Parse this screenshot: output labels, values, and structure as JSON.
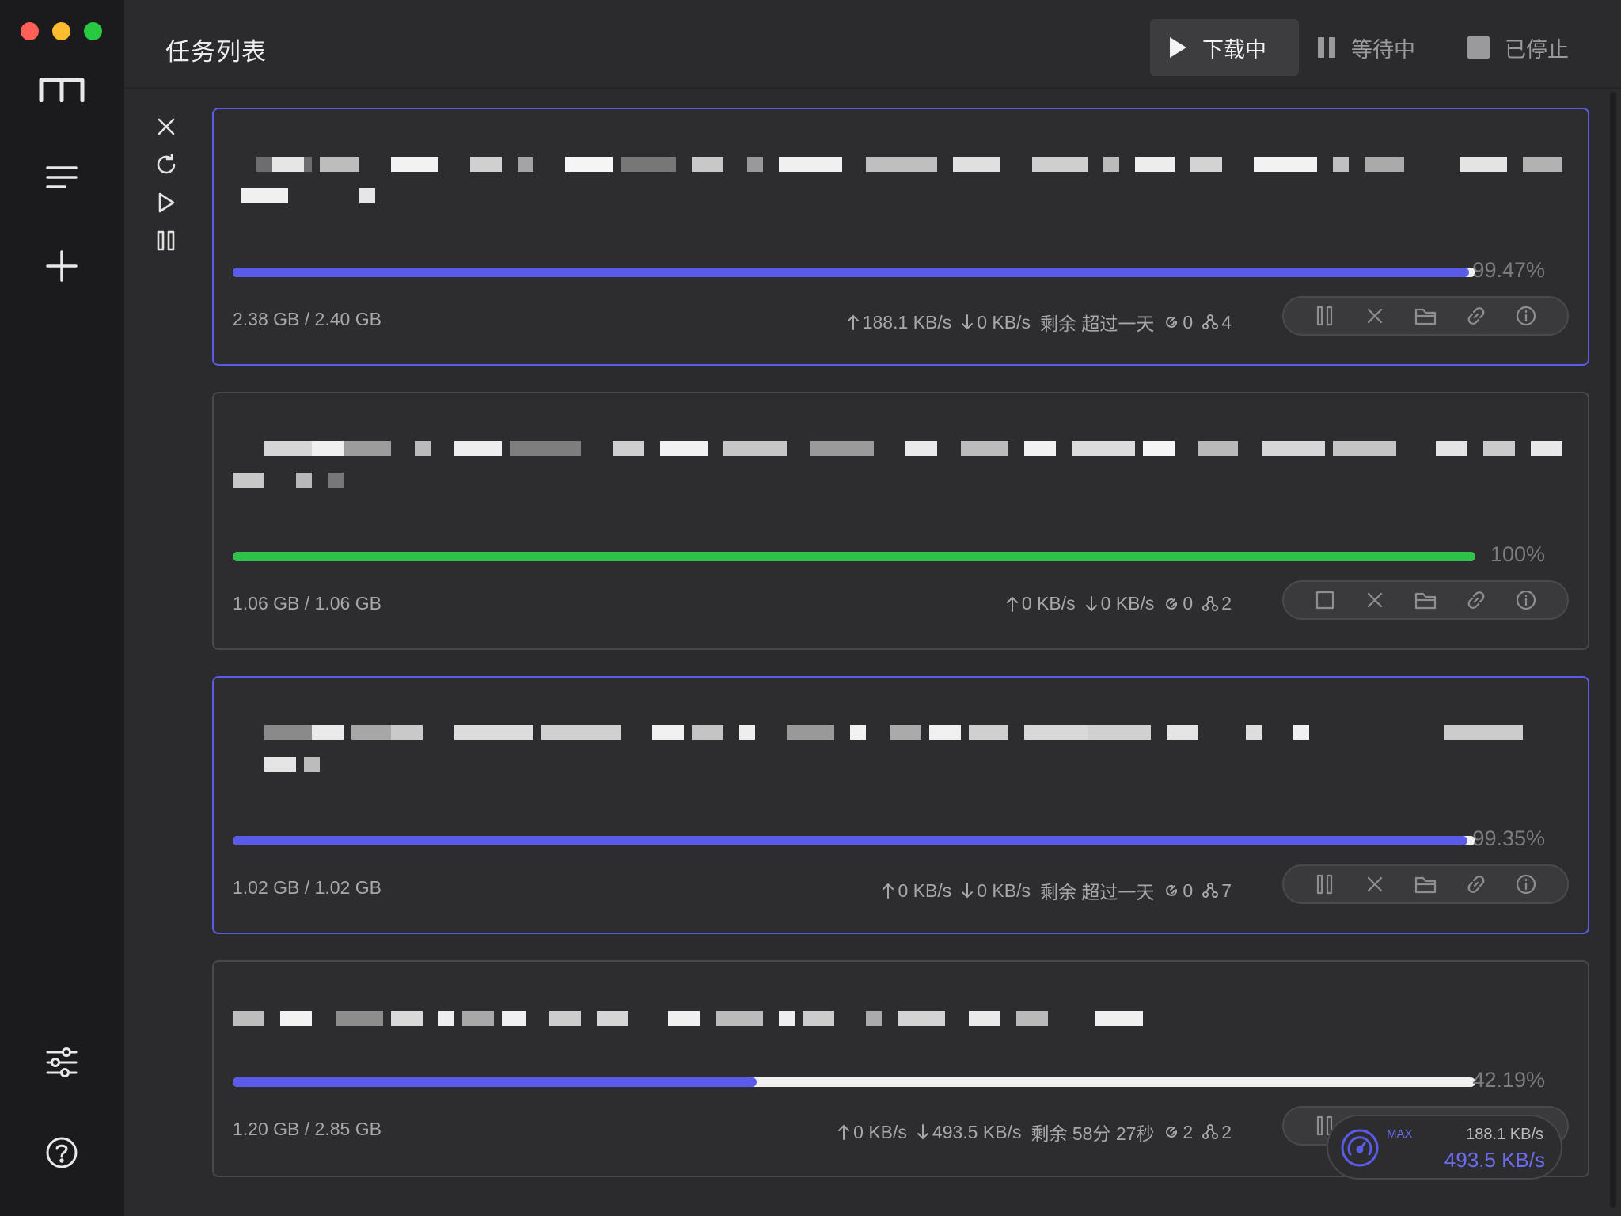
{
  "window": {
    "traffic_lights": [
      "close",
      "minimize",
      "zoom"
    ]
  },
  "sidebar": {
    "items": [
      {
        "icon": "logo-icon"
      },
      {
        "icon": "menu-icon"
      },
      {
        "icon": "add-icon"
      },
      {
        "icon": "preferences-icon"
      },
      {
        "icon": "help-icon"
      }
    ]
  },
  "header": {
    "title": "任务列表",
    "filters": [
      {
        "label": "下载中",
        "icon": "play-icon",
        "active": true
      },
      {
        "label": "等待中",
        "icon": "pause-icon",
        "active": false
      },
      {
        "label": "已停止",
        "icon": "stop-icon",
        "active": false
      }
    ]
  },
  "toolbar": {
    "items": [
      "close-icon",
      "refresh-icon",
      "play-icon",
      "pause-icon"
    ]
  },
  "tasks": [
    {
      "progress": 0.9947,
      "percent": "99.47%",
      "size": "2.38 GB / 2.40 GB",
      "upload": "188.1 KB/s",
      "download": "0 KB/s",
      "remaining": "剩余 超过一天",
      "connections": "0",
      "peers": "4",
      "status_color": "#5b5bea",
      "selected": true
    },
    {
      "progress": 1.0,
      "percent": "100%",
      "size": "1.06 GB / 1.06 GB",
      "upload": "0 KB/s",
      "download": "0 KB/s",
      "remaining": "",
      "connections": "0",
      "peers": "2",
      "status_color": "#2fc349",
      "selected": false
    },
    {
      "progress": 0.9935,
      "percent": "99.35%",
      "size": "1.02 GB / 1.02 GB",
      "upload": "0 KB/s",
      "download": "0 KB/s",
      "remaining": "剩余 超过一天",
      "connections": "0",
      "peers": "7",
      "status_color": "#5b5bea",
      "selected": true
    },
    {
      "progress": 0.4219,
      "percent": "42.19%",
      "size": "1.20 GB / 2.85 GB",
      "upload": "0 KB/s",
      "download": "493.5 KB/s",
      "remaining": "剩余 58分 27秒",
      "connections": "2",
      "peers": "2",
      "status_color": "#5b5bea",
      "selected": false
    }
  ],
  "speedometer": {
    "label": "MAX",
    "upload": "188.1 KB/s",
    "download": "493.5 KB/s"
  }
}
